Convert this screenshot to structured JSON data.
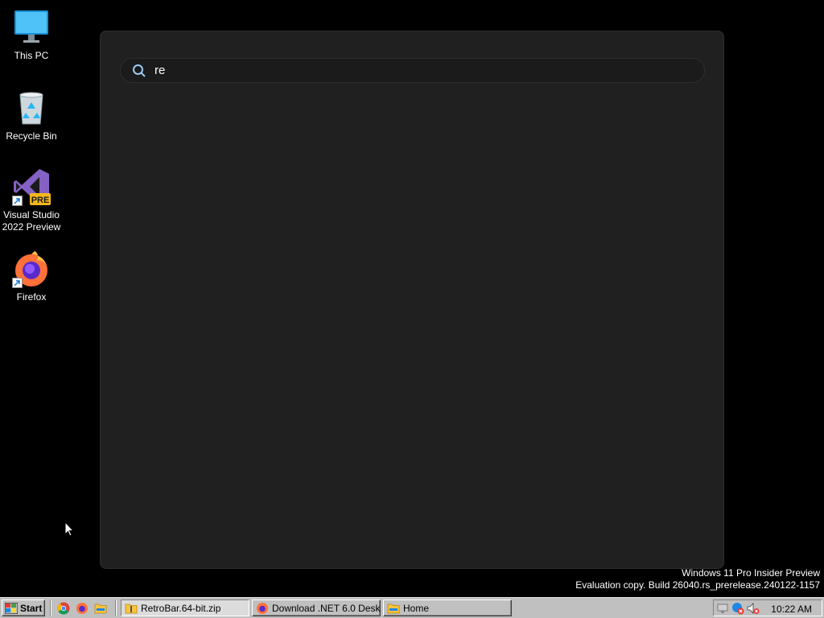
{
  "desktop": {
    "icons": [
      {
        "label": "This PC",
        "name": "this-pc-icon"
      },
      {
        "label": "Recycle Bin",
        "name": "recycle-bin-icon"
      },
      {
        "label": "Visual Studio 2022 Preview",
        "name": "visual-studio-icon",
        "badge": "PRE"
      },
      {
        "label": "Firefox",
        "name": "firefox-icon"
      }
    ]
  },
  "search": {
    "query": "re",
    "icon": "search-icon"
  },
  "watermark": {
    "line1": "Windows 11 Pro Insider Preview",
    "line2": "Evaluation copy. Build 26040.rs_prerelease.240122-1157"
  },
  "taskbar": {
    "start_label": "Start",
    "quick_launch": [
      "chrome-icon",
      "firefox-icon",
      "file-explorer-icon"
    ],
    "tasks": [
      {
        "label": "RetroBar.64-bit.zip",
        "icon": "zip-folder-icon"
      },
      {
        "label": "Download .NET 6.0 Deskt...",
        "icon": "firefox-icon"
      },
      {
        "label": "Home",
        "icon": "folder-icon"
      }
    ],
    "tray_icons": [
      "network-icon",
      "security-icon",
      "volume-muted-icon"
    ],
    "clock": "10:22 AM"
  },
  "colors": {
    "desktop_bg": "#000000",
    "panel_bg": "#202020",
    "taskbar_bg": "#c0c0c0"
  }
}
